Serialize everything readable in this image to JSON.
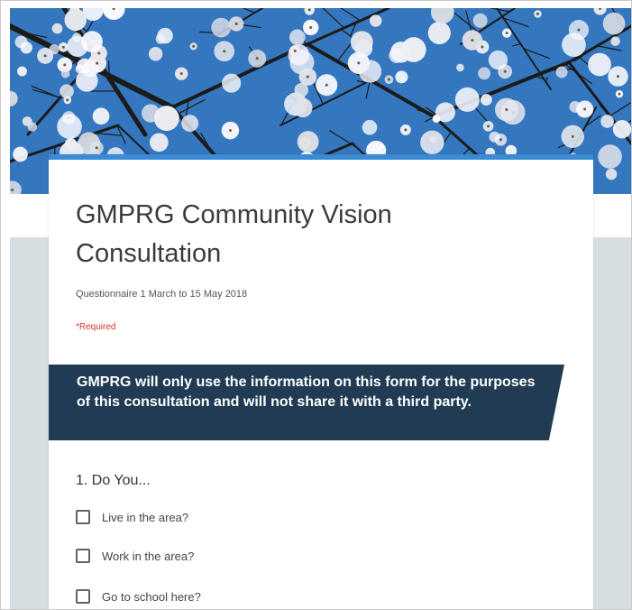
{
  "form": {
    "title": "GMPRG Community Vision Consultation",
    "subtitle": "Questionnaire 1 March to 15 May 2018",
    "required_note": "*Required",
    "notice": "GMPRG will only use the information on this form for the purposes of this consultation and will not share it with a third party.",
    "question": {
      "label": "1. Do You...",
      "options": [
        {
          "label": "Live in the area?",
          "checked": false
        },
        {
          "label": "Work in the area?",
          "checked": false
        },
        {
          "label": "Go to school here?",
          "checked": false
        }
      ]
    }
  },
  "colors": {
    "accent": "#3a8bd6",
    "notice_bg": "#213b54",
    "required": "#d93025",
    "side_panel": "#d6dee2",
    "sky": "#2f6fb6"
  }
}
